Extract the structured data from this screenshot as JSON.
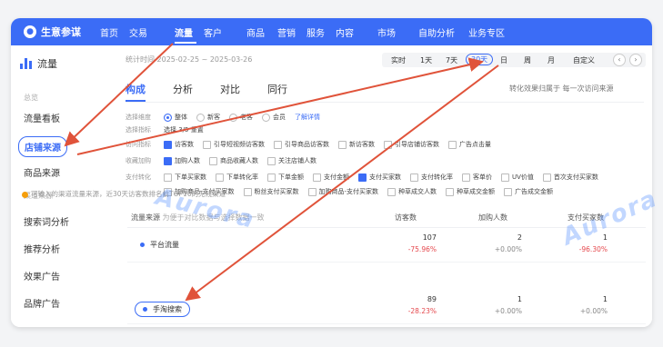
{
  "topnav": {
    "brand": "生意参谋",
    "items": [
      "首页",
      "交易",
      "流量",
      "客户",
      "商品",
      "营销",
      "服务",
      "内容",
      "市场",
      "自助分析",
      "业务专区"
    ],
    "active": "流量"
  },
  "sidebar": {
    "title": "流量",
    "group1": "总览",
    "items1": [
      "流量看板",
      "店铺来源",
      "商品来源"
    ],
    "group2": "渠道来源",
    "items2": [
      "搜索词分析",
      "推荐分析",
      "效果广告",
      "品牌广告"
    ],
    "active": "店铺来源"
  },
  "header": {
    "date_range": "统计时间 2025-02-25 ~ 2025-03-26",
    "range_buttons": [
      "实时",
      "1天",
      "7天",
      "30天",
      "日",
      "周",
      "月",
      "自定义"
    ],
    "range_active": "30天"
  },
  "tabs": {
    "items": [
      "构成",
      "分析",
      "对比",
      "同行"
    ],
    "active": "构成",
    "right": "转化效果归属于  每一次访问来源"
  },
  "filters": {
    "row1": {
      "label": "选择维度",
      "options": [
        "整体",
        "新客",
        "老客",
        "会员"
      ],
      "selected": "整体",
      "link": "了解详情"
    },
    "row2": {
      "label": "选择指标",
      "text": "选择 3/5  重置"
    },
    "row3": {
      "label": "访问指标",
      "options": [
        "访客数",
        "引导短视频访客数",
        "引导商品访客数",
        "新访客数",
        "引导店铺访客数",
        "广告点击量"
      ],
      "checked": [
        "访客数"
      ]
    },
    "row4": {
      "label": "收藏加购",
      "options": [
        "加购人数",
        "商品收藏人数",
        "关注店铺人数"
      ],
      "checked": [
        "加购人数"
      ]
    },
    "row5": {
      "label": "支付转化",
      "options": [
        "下单买家数",
        "下单转化率",
        "下单金额",
        "支付金额",
        "支付买家数",
        "支付转化率",
        "客单价",
        "UV价值",
        "首次支付买家数"
      ],
      "checked": [
        "支付买家数"
      ]
    },
    "row6": {
      "label": "",
      "options": [
        "加购商品-支付买家数",
        "粉丝支付买家数",
        "加购商品-支付买家数",
        "种草成交人数",
        "种草成交金额",
        "广告成交金额"
      ],
      "checked": []
    }
  },
  "tip": "可输入的渠道流量来源，近30天访客数排名前TOP10的无线渠道",
  "table": {
    "headers": {
      "source": "流量来源",
      "source_hint": "为便于对比数据与选择数据一致",
      "c1": "访客数",
      "c2": "加购人数",
      "c3": "支付买家数"
    },
    "rows": [
      {
        "name": "平台流量",
        "c1": "107",
        "c1d": "-75.96%",
        "c2": "2",
        "c2d": "+0.00%",
        "c3": "1",
        "c3d": "-96.30%"
      },
      {
        "name": "手淘搜索",
        "c1": "89",
        "c1d": "-28.23%",
        "c2": "1",
        "c2d": "+0.00%",
        "c3": "1",
        "c3d": "+0.00%"
      }
    ]
  },
  "watermark": "Aurora",
  "colors": {
    "accent": "#3b6cf6",
    "annotation": "#e0533a",
    "negative": "#e5484d"
  }
}
